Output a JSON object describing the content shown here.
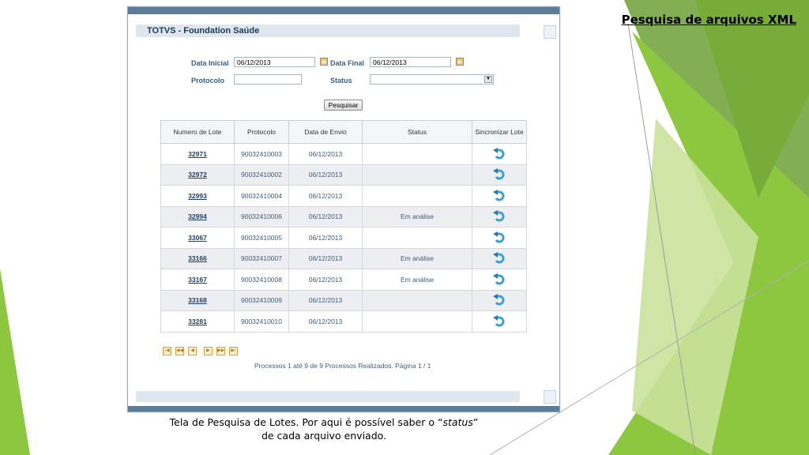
{
  "slide": {
    "title": "Pesquisa de arquivos XML",
    "caption_before": "Tela de Pesquisa de Lotes. Por aqui é possível saber o “",
    "caption_em": "status",
    "caption_after": "”",
    "caption_line2": "de cada arquivo enviado."
  },
  "app": {
    "title": "TOTVS - Foundation Saúde"
  },
  "form": {
    "data_inicial_label": "Data Inicial",
    "data_inicial_value": "06/12/2013",
    "data_final_label": "Data Final",
    "data_final_value": "06/12/2013",
    "protocolo_label": "Protocolo",
    "protocolo_value": "",
    "status_label": "Status",
    "status_value": "",
    "search_button": "Pesquisar"
  },
  "table": {
    "headers": [
      "Numero de Lote",
      "Protocolo",
      "Data de Envio",
      "Status",
      "Sincronizar Lote"
    ],
    "rows": [
      {
        "lote": "32971",
        "protocolo": "90032410003",
        "data": "06/12/2013",
        "status": ""
      },
      {
        "lote": "32972",
        "protocolo": "90032410002",
        "data": "06/12/2013",
        "status": ""
      },
      {
        "lote": "32993",
        "protocolo": "90032410004",
        "data": "06/12/2013",
        "status": ""
      },
      {
        "lote": "32994",
        "protocolo": "90032410006",
        "data": "06/12/2013",
        "status": "Em análise"
      },
      {
        "lote": "33067",
        "protocolo": "90032410005",
        "data": "06/12/2013",
        "status": ""
      },
      {
        "lote": "33166",
        "protocolo": "90032410007",
        "data": "06/12/2013",
        "status": "Em análise"
      },
      {
        "lote": "33167",
        "protocolo": "90032410008",
        "data": "06/12/2013",
        "status": "Em análise"
      },
      {
        "lote": "33168",
        "protocolo": "90032410009",
        "data": "06/12/2013",
        "status": ""
      },
      {
        "lote": "33281",
        "protocolo": "90032410010",
        "data": "06/12/2013",
        "status": ""
      }
    ]
  },
  "pager": {
    "icons": [
      "first-page-icon",
      "previous-block-icon",
      "previous-page-icon",
      "next-page-icon",
      "next-block-icon",
      "last-page-icon"
    ],
    "status_text": "Processos 1 até 9 de 9 Processos Realizados. Página 1 / 1"
  },
  "colors": {
    "accent_green": "#8dc63f",
    "window_bar": "#5b7d99",
    "link": "#1d3f66"
  }
}
